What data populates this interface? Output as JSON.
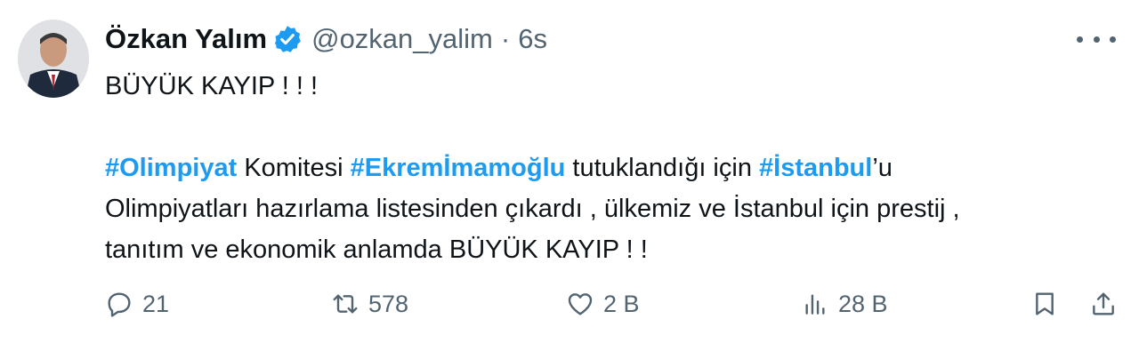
{
  "author": {
    "name": "Özkan Yalım",
    "handle": "@ozkan_yalim",
    "separator": "·",
    "time": "6s",
    "avatar_icon": "avatar",
    "verified_icon": "verified-badge-icon",
    "verified_color": "#1d9bf0"
  },
  "tweet": {
    "line1": "BÜYÜK KAYIP ! ! !",
    "p2": {
      "tag1": "#Olimpiyat",
      "t1": " Komitesi ",
      "tag2": "#Ekremİmamoğlu",
      "t2": " tutuklandığı için ",
      "tag3": "#İstanbul",
      "t3": "’u"
    },
    "line3": "Olimpiyatları hazırlama listesinden çıkardı , ülkemiz ve İstanbul için prestij ,",
    "line4": "tanıtım ve  ekonomik anlamda BÜYÜK KAYIP ! !",
    "hashtag_color": "#1d9bf0"
  },
  "actions": {
    "reply_count": "21",
    "retweet_count": "578",
    "like_count": "2 B",
    "views_count": "28 B",
    "icon_color": "#536471"
  }
}
